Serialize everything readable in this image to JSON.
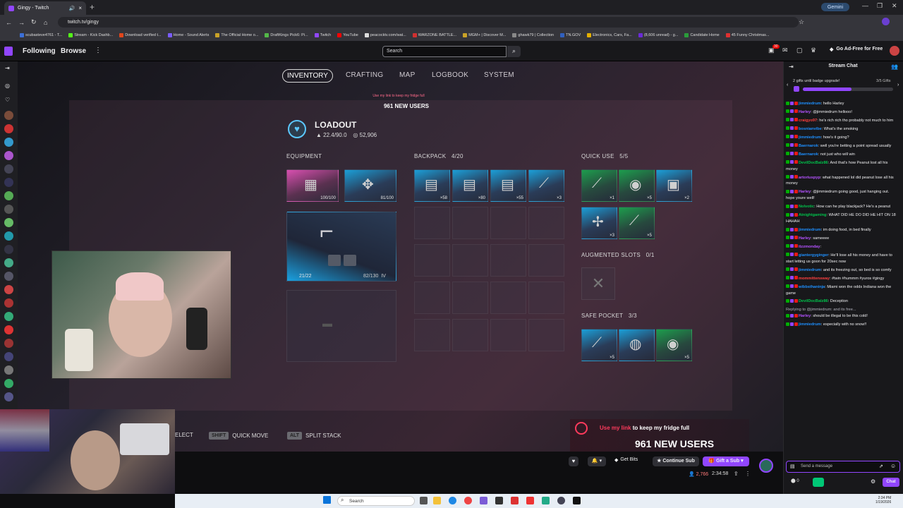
{
  "browser": {
    "tab_title": "Gingy - Twitch",
    "url": "twitch.tv/gingy",
    "gemini_label": "Gemini",
    "bookmarks": [
      {
        "label": "scubasteve4761 - T...",
        "color": "#3b6fd8"
      },
      {
        "label": "Stream - Kick Dashb...",
        "color": "#53fc18"
      },
      {
        "label": "Download verified t...",
        "color": "#e0461c"
      },
      {
        "label": "Home - Sound Alerts",
        "color": "#7a5cff"
      },
      {
        "label": "The Official Home o...",
        "color": "#c9a227"
      },
      {
        "label": "DraftKings Pick6: Pi...",
        "color": "#53b848"
      },
      {
        "label": "Twitch",
        "color": "#9146ff"
      },
      {
        "label": "YouTube",
        "color": "#ff0000"
      },
      {
        "label": "peacocktv.com/wat...",
        "color": "#dddddd"
      },
      {
        "label": "WARZONE BATTLE...",
        "color": "#d03030"
      },
      {
        "label": "MGM+ | Discover M...",
        "color": "#c9a227"
      },
      {
        "label": "ghawk79 | Collection",
        "color": "#888888"
      },
      {
        "label": "TN.GOV",
        "color": "#3060c0"
      },
      {
        "label": "Electronics, Cars, Fa...",
        "color": "#e5b000"
      },
      {
        "label": "(8,606 unread) - g...",
        "color": "#6b2bd8"
      },
      {
        "label": "Candidate Home",
        "color": "#2a9d3a"
      },
      {
        "label": "45 Funny Christmas...",
        "color": "#e03030"
      }
    ]
  },
  "twitch": {
    "nav_following": "Following",
    "nav_browse": "Browse",
    "search_placeholder": "Search",
    "notification_count": "30",
    "ad_free": "Go Ad-Free for Free"
  },
  "game": {
    "tabs": [
      "INVENTORY",
      "CRAFTING",
      "MAP",
      "LOGBOOK",
      "SYSTEM"
    ],
    "promo_line": "Use my link to keep my fridge full",
    "promo_users": "961 NEW USERS",
    "loadout_title": "LOADOUT",
    "weight": "22.4/90.0",
    "currency": "52,906",
    "equipment_label": "EQUIPMENT",
    "backpack_label": "BACKPACK",
    "backpack_count": "4/20",
    "quick_use_label": "QUICK USE",
    "quick_use_count": "5/5",
    "augmented_label": "AUGMENTED SLOTS",
    "augmented_count": "0/1",
    "safe_pocket_label": "SAFE POCKET",
    "safe_pocket_count": "3/3",
    "equipment": [
      {
        "durability": "100/100",
        "color": "pink"
      },
      {
        "durability": "81/100",
        "color": "blue"
      }
    ],
    "weapon_ammo": "21/22",
    "weapon_durability": "82/130",
    "weapon_tier": "IV",
    "backpack_items": [
      "×58",
      "×80",
      "×55",
      "×3"
    ],
    "quick_use_items": [
      "×1",
      "×5",
      "×2",
      "×3",
      "×5"
    ],
    "safe_pocket_items": [
      "×5",
      "",
      "×5"
    ],
    "prompts": [
      {
        "key": "",
        "label": "ELECT"
      },
      {
        "key": "SHIFT",
        "label": "QUICK MOVE"
      },
      {
        "key": "ALT",
        "label": "SPLIT STACK"
      }
    ],
    "banner_highlight": "Use my link",
    "banner_rest": " to keep my fridge full",
    "banner_users": "961 NEW USERS"
  },
  "player": {
    "get_bits": "Get Bits",
    "continue_sub": "Continue Sub",
    "gift_sub": "Gift a Sub",
    "viewers": "2,766",
    "uptime": "2:34:58"
  },
  "chat": {
    "title": "Stream Chat",
    "gift_banner": "2 gifts until badge upgrade!",
    "gift_count": "3/5 Gifts",
    "gift_progress": 0.54,
    "input_placeholder": "Send a message",
    "points": "0",
    "chat_button": "Chat",
    "messages": [
      {
        "user": "jimmiedrum",
        "color": "#1e90ff",
        "text": "hello Harley"
      },
      {
        "user": "Harley",
        "color": "#b452ff",
        "text": "@jimmiedrum hellooo!"
      },
      {
        "user": "craigyo97",
        "color": "#ff4040",
        "text": "he's rich rich tho probably not much to him"
      },
      {
        "user": "bosnianvibe",
        "color": "#1e90ff",
        "text": "What's the smoking"
      },
      {
        "user": "jimmiedrum",
        "color": "#1e90ff",
        "text": "how's it going?"
      },
      {
        "user": "Baernarok",
        "color": "#1e90ff",
        "text": "well you're betting a point spread usually"
      },
      {
        "user": "Baernarok",
        "color": "#1e90ff",
        "text": "not just who will win"
      },
      {
        "user": "DevilDocBalz86",
        "color": "#00c24b",
        "text": "And that's how Peanut lost all his money"
      },
      {
        "user": "artoriuspyp",
        "color": "#b452ff",
        "text": "what happened lol did peanut lose all his money"
      },
      {
        "user": "Harley",
        "color": "#b452ff",
        "text": "@jimmiedrum going good, just hanging out. hope youre well!"
      },
      {
        "user": "Nolvotic",
        "color": "#00c24b",
        "text": "How can he play blackjack? He's a peanut"
      },
      {
        "user": "Atnightgaming",
        "color": "#00c24b",
        "text": "WHAT DID HE DO DID HE HIT ON 18 HAHAH"
      },
      {
        "user": "jimmiedrum",
        "color": "#1e90ff",
        "text": "im doing food, in bed finally"
      },
      {
        "user": "Harley",
        "color": "#b452ff",
        "text": "sameeee"
      },
      {
        "user": "itzzmonday",
        "color": "#b452ff",
        "text": ""
      },
      {
        "user": "giantergyginger",
        "color": "#1e90ff",
        "text": "He'll lose all his money and have to start letting us goon for 20sec now"
      },
      {
        "user": "jimmiedrum",
        "color": "#1e90ff",
        "text": "and its freezing out, so bed is so comfy"
      },
      {
        "user": "mommittensway",
        "color": "#ff4040",
        "text": "#twin #hummm #yuros #gingy"
      },
      {
        "user": "wibbsthaninja",
        "color": "#1e90ff",
        "text": "Miami won the odds Indiana won the game"
      },
      {
        "user": "DevilDocBalz86",
        "color": "#00c24b",
        "text": "Deception"
      },
      {
        "user": "Harley",
        "color": "#b452ff",
        "text": "should be illegal to be this cold!",
        "reply": "Replying to @jimmiedrum: and its free..."
      },
      {
        "user": "jimmiedrum",
        "color": "#1e90ff",
        "text": "especially with no snow!!"
      }
    ]
  },
  "taskbar": {
    "search_placeholder": "Search",
    "time": "2:34 PM",
    "date": "1/19/2026"
  }
}
